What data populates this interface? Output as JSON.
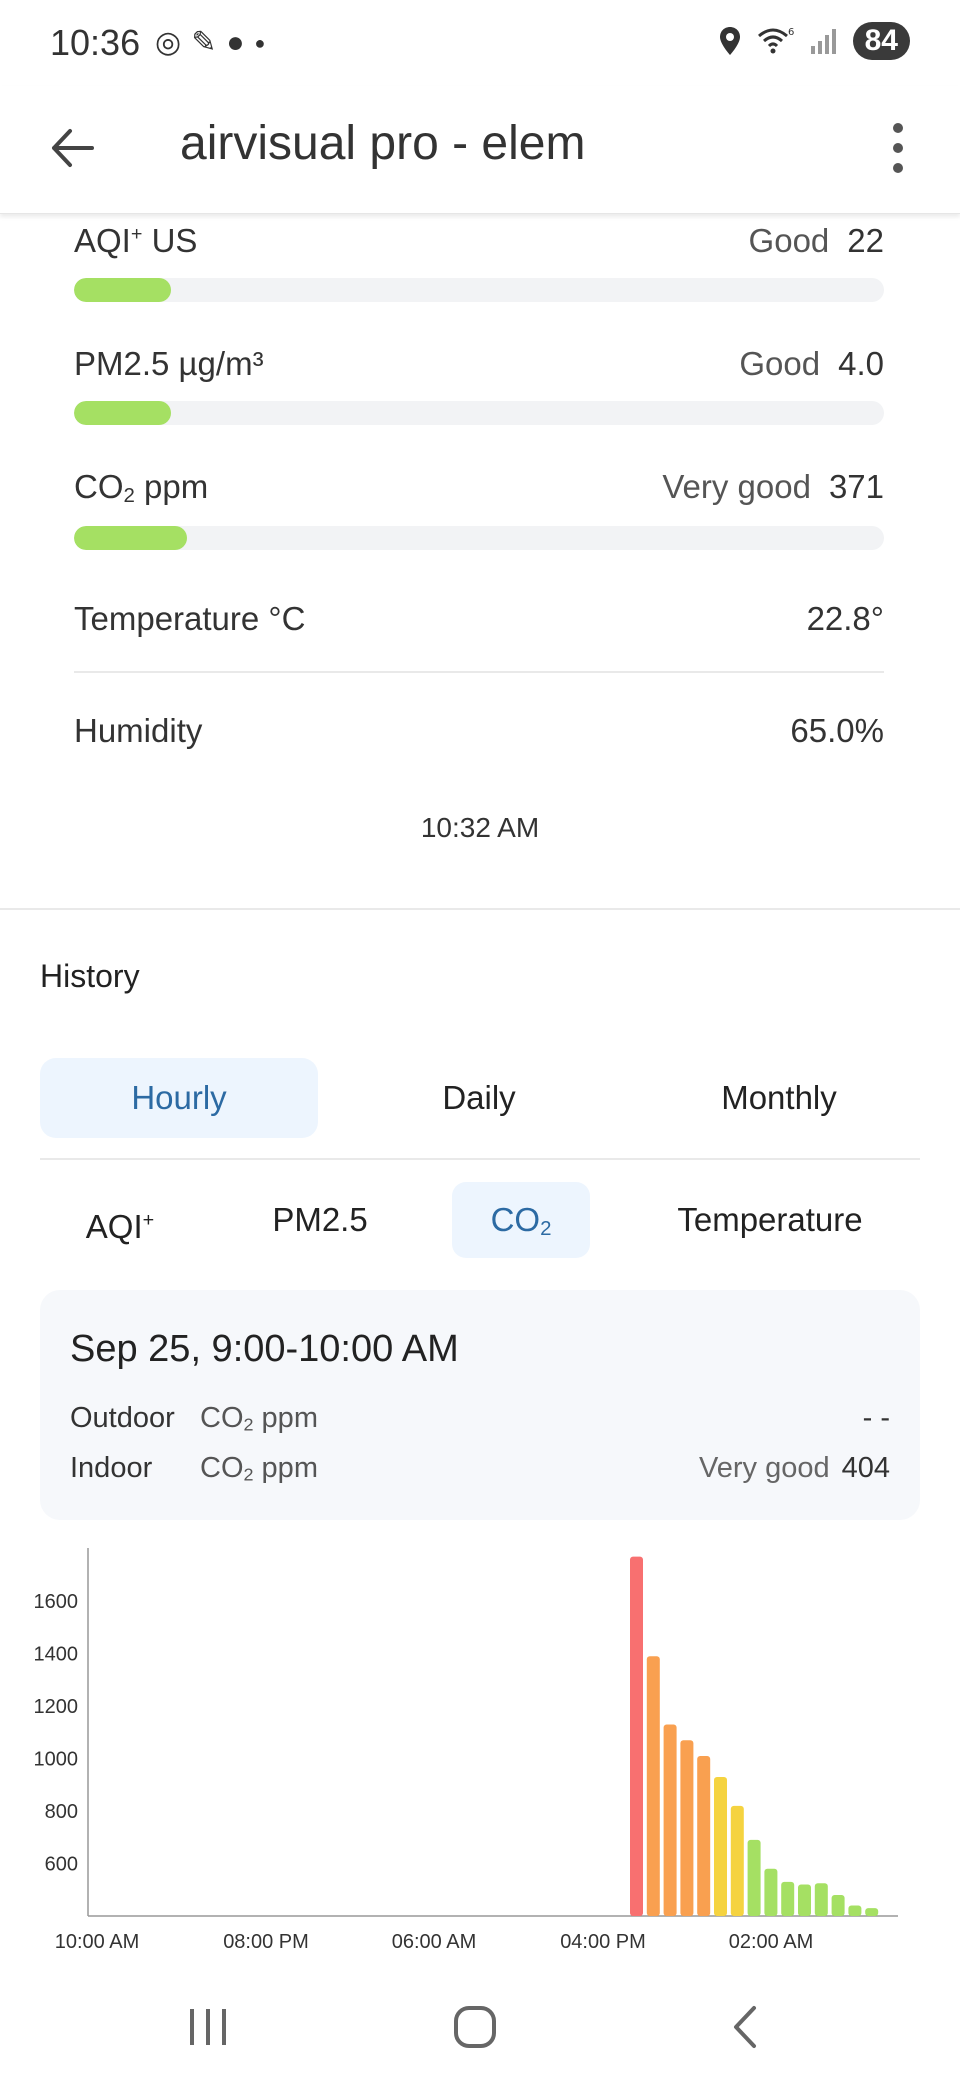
{
  "status_bar": {
    "time": "10:36",
    "battery": "84",
    "left_icons": [
      "at-sign-icon",
      "feather-icon",
      "chat-bubble-icon",
      "dot-icon"
    ],
    "right_icons": [
      "location-pin-icon",
      "wifi-icon",
      "signal-icon"
    ]
  },
  "app_bar": {
    "title": "airvisual pro - elem"
  },
  "readings": [
    {
      "label": "AQI",
      "label_sup": "+",
      "label_suffix": " US",
      "status": "Good",
      "value": "22",
      "fill": 0.12
    },
    {
      "label": "PM2.5 µg/m³",
      "label_sup": "",
      "label_suffix": "",
      "status": "Good",
      "value": "4.0",
      "fill": 0.12
    },
    {
      "label": "CO",
      "label_sub": "2",
      "label_suffix": " ppm",
      "status": "Very good",
      "value": "371",
      "fill": 0.14
    }
  ],
  "temperature": {
    "label": "Temperature °C",
    "value": "22.8°"
  },
  "humidity": {
    "label": "Humidity",
    "value": "65.0%"
  },
  "timestamp": "10:32 AM",
  "history": {
    "title": "History",
    "ranges": [
      "Hourly",
      "Daily",
      "Monthly"
    ],
    "active_range": "Hourly",
    "metrics": [
      {
        "label": "AQI",
        "sup": "+",
        "sub": ""
      },
      {
        "label": "PM2.5",
        "sup": "",
        "sub": ""
      },
      {
        "label": "CO",
        "sup": "",
        "sub": "2"
      },
      {
        "label": "Temperature",
        "sup": "",
        "sub": ""
      }
    ],
    "active_metric": "CO2",
    "summary": {
      "date": "Sep 25, 9:00-10:00 AM",
      "outdoor": {
        "label": "Outdoor",
        "unit_base": "CO",
        "unit_sub": "2",
        "unit_suffix": " ppm",
        "status": "",
        "value": "- -"
      },
      "indoor": {
        "label": "Indoor",
        "unit_base": "CO",
        "unit_sub": "2",
        "unit_suffix": " ppm",
        "status": "Very good",
        "value": "404"
      }
    }
  },
  "colors": {
    "good_green": "#a5e063",
    "yellow": "#f5d340",
    "orange": "#f9a050",
    "red": "#f87070",
    "accent_blue": "#2c6aa3"
  },
  "chart_data": {
    "type": "bar",
    "title": "",
    "ylabel": "",
    "xlabel": "",
    "ylim": [
      400,
      1780
    ],
    "y_ticks": [
      600,
      800,
      1000,
      1200,
      1400,
      1600
    ],
    "x_tick_labels": [
      "10:00 AM",
      "08:00 PM",
      "06:00 AM",
      "04:00 PM",
      "02:00 AM"
    ],
    "values": [
      1770,
      1390,
      1130,
      1070,
      1010,
      930,
      820,
      690,
      580,
      530,
      520,
      525,
      480,
      440,
      430
    ],
    "colors": [
      "#f87070",
      "#f9a050",
      "#f9a050",
      "#f9a050",
      "#f9a050",
      "#f5d340",
      "#f5d340",
      "#a5e063",
      "#a5e063",
      "#a5e063",
      "#a5e063",
      "#a5e063",
      "#a5e063",
      "#a5e063",
      "#a5e063"
    ],
    "grid": false
  }
}
